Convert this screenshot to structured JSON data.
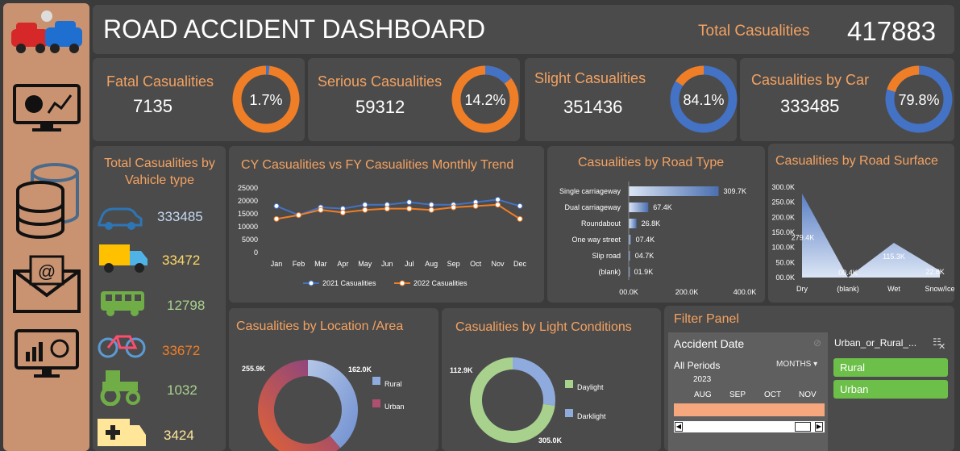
{
  "header": {
    "title": "ROAD  ACCIDENT DASHBOARD",
    "total_label": "Total Casualities",
    "total_value": "417883"
  },
  "kpis": [
    {
      "title": "Fatal Casualities",
      "value": "7135",
      "pct": "1.7%",
      "fraction": 0.017
    },
    {
      "title": "Serious Casualities",
      "value": "59312",
      "pct": "14.2%",
      "fraction": 0.142
    },
    {
      "title": "Slight Casualities",
      "value": "351436",
      "pct": "84.1%",
      "fraction": 0.841
    },
    {
      "title": "Casualities by Car",
      "value": "333485",
      "pct": "79.8%",
      "fraction": 0.798
    }
  ],
  "colors": {
    "orange": "#f07e26",
    "blue": "#4472c4",
    "panel": "#4b4b4b",
    "accent": "#f4a261"
  },
  "sidebar": {
    "icons": [
      "crash-logo-icon",
      "monitor-chart-icon",
      "database-icon",
      "mail-icon",
      "analytics-board-icon"
    ]
  },
  "vehicle": {
    "title": "Total Casualities by Vahicle type",
    "items": [
      {
        "icon": "car-icon",
        "value": "333485",
        "color": "#c5d9f1"
      },
      {
        "icon": "truck-icon",
        "value": "33472",
        "color": "#ffd966"
      },
      {
        "icon": "bus-icon",
        "value": "12798",
        "color": "#a9d18e"
      },
      {
        "icon": "bicycle-icon",
        "value": "33672",
        "color": "#f07e26"
      },
      {
        "icon": "tractor-icon",
        "value": "1032",
        "color": "#a9d18e"
      },
      {
        "icon": "ambulance-icon",
        "value": "3424",
        "color": "#ffe699"
      }
    ]
  },
  "trend": {
    "title": "CY Casualities  vs FY Casualities Monthly Trend",
    "legend": [
      "2021 Casualities",
      "2022 Casualities"
    ]
  },
  "road_type": {
    "title": "Casualities by Road Type"
  },
  "road_surface": {
    "title": "Casualities by Road Surface"
  },
  "location": {
    "title": "Casualities by Location /Area",
    "legend": [
      "Rural",
      "Urban"
    ]
  },
  "light": {
    "title": "Casualities by Light Conditions",
    "legend": [
      "Daylight",
      "Darklight"
    ]
  },
  "filter": {
    "title": "Filter Panel",
    "date_label": "Accident Date",
    "all_periods": "All Periods",
    "months_label": "MONTHS",
    "year": "2023",
    "months": [
      "AUG",
      "SEP",
      "OCT",
      "NOV"
    ],
    "slicer_title": "Urban_or_Rural_...",
    "slicer_items": [
      "Rural",
      "Urban"
    ]
  },
  "chart_data": [
    {
      "type": "line",
      "title": "CY Casualities  vs FY Casualities Monthly Trend",
      "categories": [
        "Jan",
        "Feb",
        "Mar",
        "Apr",
        "May",
        "Jun",
        "Jul",
        "Aug",
        "Sep",
        "Oct",
        "Nov",
        "Dec"
      ],
      "series": [
        {
          "name": "2021 Casualities",
          "values": [
            18000,
            14500,
            17500,
            17000,
            18500,
            18500,
            19500,
            18500,
            18500,
            19500,
            20500,
            18000
          ]
        },
        {
          "name": "2022 Casualities",
          "values": [
            13000,
            14500,
            16500,
            15500,
            16500,
            17000,
            17000,
            16500,
            17500,
            18000,
            18500,
            13000
          ]
        }
      ],
      "yticks": [
        "25000",
        "20000",
        "15000",
        "10000",
        "5000",
        "0"
      ],
      "ylim": [
        0,
        25000
      ]
    },
    {
      "type": "bar",
      "title": "Casualities by Road Type",
      "categories": [
        "Single carriageway",
        "Dual carriageway",
        "Roundabout",
        "One way street",
        "Slip road",
        "(blank)"
      ],
      "values": [
        309.7,
        67.4,
        26.8,
        7.4,
        4.7,
        1.9
      ],
      "labels": [
        "309.7K",
        "67.4K",
        "26.8K",
        "07.4K",
        "04.7K",
        "01.9K"
      ],
      "xticks": [
        "00.0K",
        "200.0K",
        "400.0K"
      ],
      "xlim": [
        0,
        400
      ]
    },
    {
      "type": "area",
      "title": "Casualities by Road Surface",
      "categories": [
        "Dry",
        "(blank)",
        "Wet",
        "Snow/Ice"
      ],
      "values": [
        279.4,
        0.4,
        115.3,
        22.8
      ],
      "labels": [
        "279.4K",
        "00.4K",
        "115.3K",
        "22.8K"
      ],
      "yticks": [
        "300.0K",
        "250.0K",
        "200.0K",
        "150.0K",
        "100.0K",
        "50.0K",
        "00.0K"
      ],
      "ylim": [
        0,
        300
      ]
    },
    {
      "type": "pie",
      "title": "Casualities by Location /Area",
      "categories": [
        "Rural",
        "Urban"
      ],
      "values": [
        162.0,
        255.9
      ],
      "labels": [
        "162.0K",
        "255.9K"
      ]
    },
    {
      "type": "pie",
      "title": "Casualities by Light Conditions",
      "categories": [
        "Daylight",
        "Darklight"
      ],
      "values": [
        305.0,
        112.9
      ],
      "labels": [
        "305.0K",
        "112.9K"
      ]
    }
  ]
}
